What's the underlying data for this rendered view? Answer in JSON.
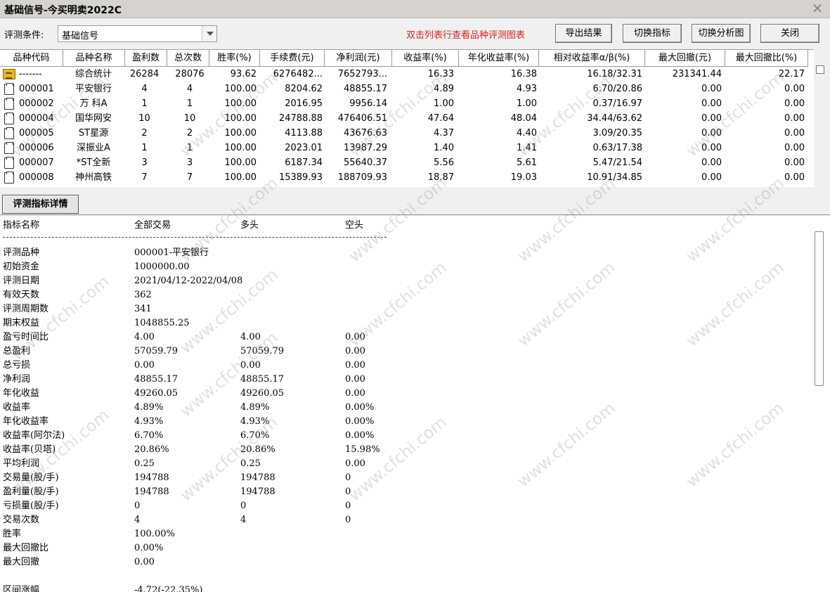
{
  "window": {
    "title": "基础信号-今买明卖2022C",
    "close_glyph": "✕"
  },
  "toolbar": {
    "condition_label": "评测条件:",
    "condition_value": "基础信号",
    "hint": "双击列表行查看品种评测图表",
    "buttons": {
      "export": "导出结果",
      "switch_indicator": "切换指标",
      "switch_chart": "切换分析图",
      "close": "关闭"
    }
  },
  "table": {
    "columns": [
      "品种代码",
      "品种名称",
      "盈利数",
      "总次数",
      "胜率(%)",
      "手续费(元)",
      "净利润(元)",
      "收益率(%)",
      "年化收益率(%)",
      "相对收益率α/β(%)",
      "最大回撤(元)",
      "最大回撤比(%)"
    ],
    "rows": [
      {
        "icon": "summary-icon",
        "code": "-------",
        "name": "综合统计",
        "wins": "26284",
        "total": "28076",
        "winrate": "93.62",
        "fee": "6276482...",
        "net": "7652793...",
        "ret": "16.33",
        "annual": "16.38",
        "alpha_beta": "16.18/32.31",
        "maxdd": "231341.44",
        "maxdd_ratio": "22.17"
      },
      {
        "icon": "document-icon",
        "code": "000001",
        "name": "平安银行",
        "wins": "4",
        "total": "4",
        "winrate": "100.00",
        "fee": "8204.62",
        "net": "48855.17",
        "ret": "4.89",
        "annual": "4.93",
        "alpha_beta": "6.70/20.86",
        "maxdd": "0.00",
        "maxdd_ratio": "0.00"
      },
      {
        "icon": "document-icon",
        "code": "000002",
        "name": "万 科A",
        "wins": "1",
        "total": "1",
        "winrate": "100.00",
        "fee": "2016.95",
        "net": "9956.14",
        "ret": "1.00",
        "annual": "1.00",
        "alpha_beta": "0.37/16.97",
        "maxdd": "0.00",
        "maxdd_ratio": "0.00"
      },
      {
        "icon": "document-icon",
        "code": "000004",
        "name": "国华网安",
        "wins": "10",
        "total": "10",
        "winrate": "100.00",
        "fee": "24788.88",
        "net": "476406.51",
        "ret": "47.64",
        "annual": "48.04",
        "alpha_beta": "34.44/63.62",
        "maxdd": "0.00",
        "maxdd_ratio": "0.00"
      },
      {
        "icon": "document-icon",
        "code": "000005",
        "name": "ST星源",
        "wins": "2",
        "total": "2",
        "winrate": "100.00",
        "fee": "4113.88",
        "net": "43676.63",
        "ret": "4.37",
        "annual": "4.40",
        "alpha_beta": "3.09/20.35",
        "maxdd": "0.00",
        "maxdd_ratio": "0.00"
      },
      {
        "icon": "document-icon",
        "code": "000006",
        "name": "深振业A",
        "wins": "1",
        "total": "1",
        "winrate": "100.00",
        "fee": "2023.01",
        "net": "13987.29",
        "ret": "1.40",
        "annual": "1.41",
        "alpha_beta": "0.63/17.38",
        "maxdd": "0.00",
        "maxdd_ratio": "0.00"
      },
      {
        "icon": "document-icon",
        "code": "000007",
        "name": "*ST全新",
        "wins": "3",
        "total": "3",
        "winrate": "100.00",
        "fee": "6187.34",
        "net": "55640.37",
        "ret": "5.56",
        "annual": "5.61",
        "alpha_beta": "5.47/21.54",
        "maxdd": "0.00",
        "maxdd_ratio": "0.00"
      },
      {
        "icon": "document-icon",
        "code": "000008",
        "name": "神州高铁",
        "wins": "7",
        "total": "7",
        "winrate": "100.00",
        "fee": "15389.93",
        "net": "188709.93",
        "ret": "18.87",
        "annual": "19.03",
        "alpha_beta": "10.91/34.85",
        "maxdd": "0.00",
        "maxdd_ratio": "0.00"
      }
    ]
  },
  "detail": {
    "tab": "评测指标详情",
    "headers": {
      "metric": "指标名称",
      "all": "全部交易",
      "long": "多头",
      "short": "空头"
    },
    "info": [
      {
        "label": "评测品种",
        "value": "000001-平安银行"
      },
      {
        "label": "初始资金",
        "value": "1000000.00"
      },
      {
        "label": "评测日期",
        "value": "2021/04/12-2022/04/08"
      },
      {
        "label": "有效天数",
        "value": "362"
      },
      {
        "label": "评测周期数",
        "value": "341"
      },
      {
        "label": "期末权益",
        "value": "1048855.25"
      }
    ],
    "metrics": [
      {
        "label": "盈亏时间比",
        "all": "4.00",
        "long": "4.00",
        "short": "0.00"
      },
      {
        "label": "总盈利",
        "all": "57059.79",
        "long": "57059.79",
        "short": "0.00"
      },
      {
        "label": "总亏损",
        "all": "0.00",
        "long": "0.00",
        "short": "0.00"
      },
      {
        "label": "净利润",
        "all": "48855.17",
        "long": "48855.17",
        "short": "0.00"
      },
      {
        "label": "年化收益",
        "all": "49260.05",
        "long": "49260.05",
        "short": "0.00"
      },
      {
        "label": "收益率",
        "all": "4.89%",
        "long": "4.89%",
        "short": "0.00%"
      },
      {
        "label": "年化收益率",
        "all": "4.93%",
        "long": "4.93%",
        "short": "0.00%"
      },
      {
        "label": "收益率(阿尔法)",
        "all": "6.70%",
        "long": "6.70%",
        "short": "0.00%"
      },
      {
        "label": "收益率(贝塔)",
        "all": "20.86%",
        "long": "20.86%",
        "short": "15.98%"
      },
      {
        "label": "平均利润",
        "all": "0.25",
        "long": "0.25",
        "short": "0.00"
      },
      {
        "label": "交易量(股/手)",
        "all": "194788",
        "long": "194788",
        "short": "0"
      },
      {
        "label": "盈利量(股/手)",
        "all": "194788",
        "long": "194788",
        "short": "0"
      },
      {
        "label": "亏损量(股/手)",
        "all": "0",
        "long": "0",
        "short": "0"
      },
      {
        "label": "交易次数",
        "all": "4",
        "long": "4",
        "short": "0"
      }
    ],
    "summary": [
      {
        "label": "胜率",
        "value": "100.00%"
      },
      {
        "label": "最大回撤比",
        "value": "0.00%"
      },
      {
        "label": "最大回撤",
        "value": "0.00"
      }
    ],
    "range": {
      "label": "区间涨幅",
      "value": "-4.72(-22.35%)"
    }
  },
  "watermark": "www.cfchi.com"
}
